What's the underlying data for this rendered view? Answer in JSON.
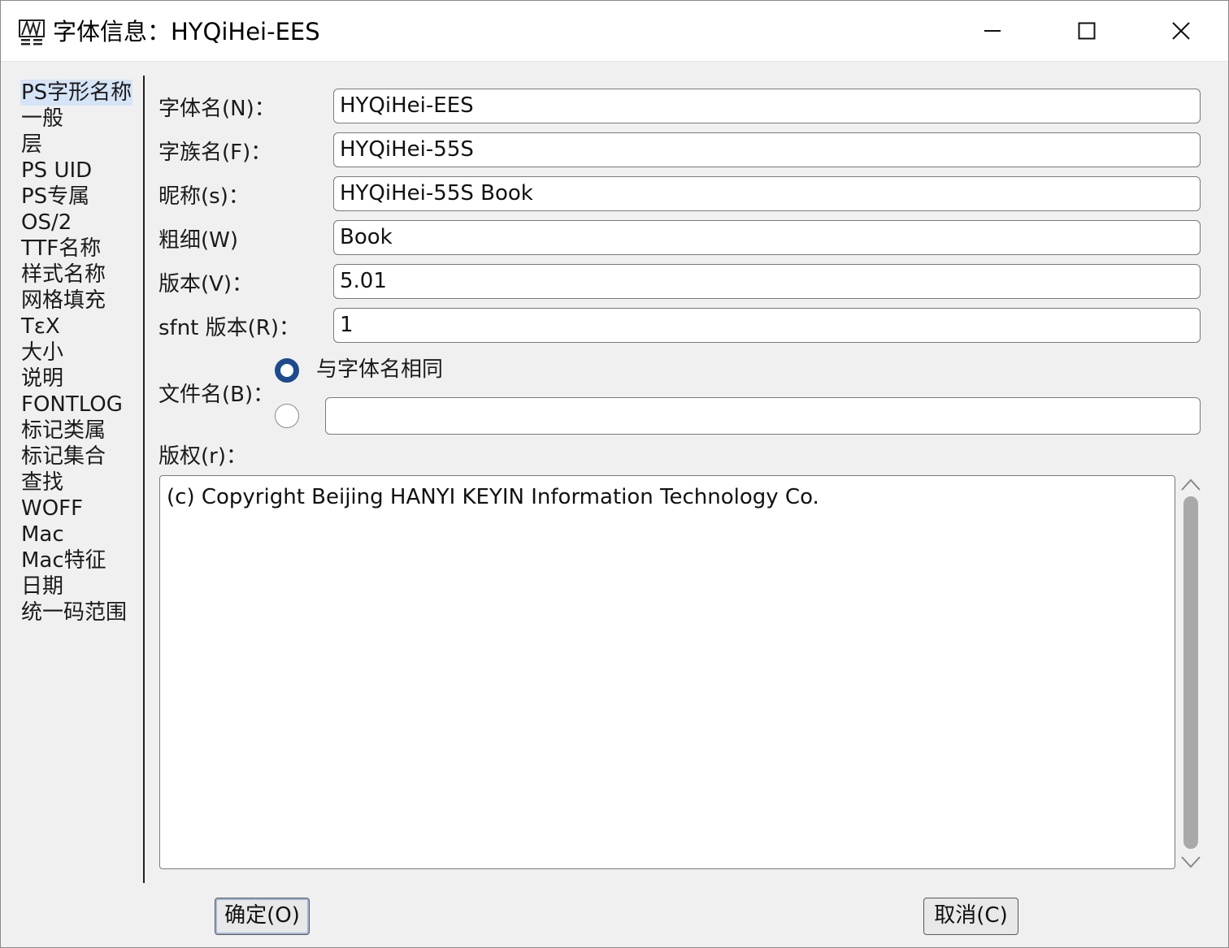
{
  "window": {
    "title": "字体信息：HYQiHei-EES",
    "controls": {
      "minimize": "minimize-icon",
      "maximize": "maximize-icon",
      "close": "close-icon"
    }
  },
  "categories": [
    "PS字形名称",
    "一般",
    "层",
    "PS UID",
    "PS专属",
    "OS/2",
    "TTF名称",
    "样式名称",
    "网格填充",
    "TεX",
    "大小",
    "说明",
    "FONTLOG",
    "标记类属",
    "标记集合",
    "查找",
    "WOFF",
    "Mac",
    "Mac特征",
    "日期",
    "统一码范围"
  ],
  "selected_category": "PS字形名称",
  "fields": {
    "fontname": {
      "label": "字体名(N)：",
      "value": "HYQiHei-EES"
    },
    "familyname": {
      "label": "字族名(F)：",
      "value": "HYQiHei-55S"
    },
    "fullname": {
      "label": "昵称(s)：",
      "value": "HYQiHei-55S Book"
    },
    "weight": {
      "label": "粗细(W)",
      "value": "Book"
    },
    "version": {
      "label": "版本(V)：",
      "value": "5.01"
    },
    "sfnt_version": {
      "label": "sfnt 版本(R)：",
      "value": "1"
    }
  },
  "filename": {
    "label": "文件名(B)：",
    "option_same": "与字体名相同",
    "option_custom_value": "",
    "selected": "same"
  },
  "copyright": {
    "label": "版权(r)：",
    "value": "(c) Copyright Beijing HANYI KEYIN Information Technology Co."
  },
  "buttons": {
    "ok": "确定(O)",
    "cancel": "取消(C)"
  },
  "colors": {
    "radio_selected": "#1d4a8c",
    "selection_highlight": "#d6e4f7"
  }
}
